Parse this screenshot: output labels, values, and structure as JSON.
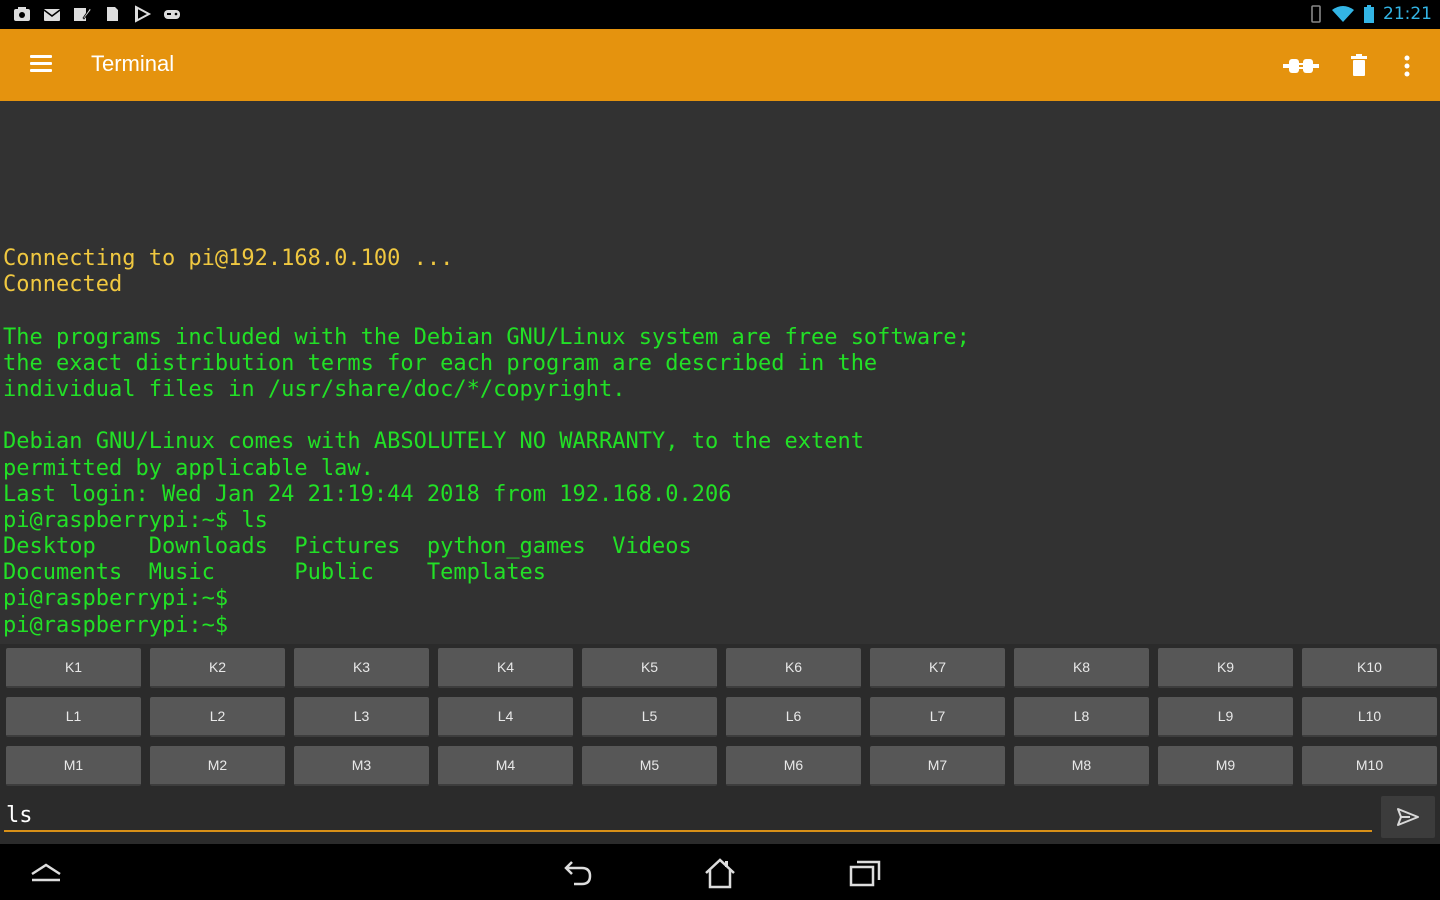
{
  "status_bar": {
    "left_icons": [
      "notification-icon",
      "mail-icon",
      "edit-icon",
      "document-icon",
      "play-store-icon",
      "gamepad-icon"
    ],
    "time": "21:21",
    "right_icons": [
      "vibrate-icon",
      "wifi-icon",
      "battery-icon"
    ]
  },
  "toolbar": {
    "title": "Terminal",
    "actions": [
      "connect-icon",
      "delete-icon",
      "overflow-menu-icon"
    ]
  },
  "terminal": {
    "lines": [
      {
        "text": "Connecting to pi@192.168.0.100 ...",
        "color": "yellow"
      },
      {
        "text": "Connected",
        "color": "yellow"
      },
      {
        "text": "",
        "color": "green"
      },
      {
        "text": "The programs included with the Debian GNU/Linux system are free software;",
        "color": "green"
      },
      {
        "text": "the exact distribution terms for each program are described in the",
        "color": "green"
      },
      {
        "text": "individual files in /usr/share/doc/*/copyright.",
        "color": "green"
      },
      {
        "text": "",
        "color": "green"
      },
      {
        "text": "Debian GNU/Linux comes with ABSOLUTELY NO WARRANTY, to the extent",
        "color": "green"
      },
      {
        "text": "permitted by applicable law.",
        "color": "green"
      },
      {
        "text": "Last login: Wed Jan 24 21:19:44 2018 from 192.168.0.206",
        "color": "green"
      },
      {
        "text": "pi@raspberrypi:~$ ls",
        "color": "green"
      },
      {
        "text": "Desktop    Downloads  Pictures  python_games  Videos",
        "color": "green"
      },
      {
        "text": "Documents  Music      Public    Templates",
        "color": "green"
      },
      {
        "text": "pi@raspberrypi:~$",
        "color": "green"
      },
      {
        "text": "pi@raspberrypi:~$",
        "color": "green"
      }
    ]
  },
  "keys": {
    "row_k": [
      "K1",
      "K2",
      "K3",
      "K4",
      "K5",
      "K6",
      "K7",
      "K8",
      "K9",
      "K10"
    ],
    "row_l": [
      "L1",
      "L2",
      "L3",
      "L4",
      "L5",
      "L6",
      "L7",
      "L8",
      "L9",
      "L10"
    ],
    "row_m": [
      "M1",
      "M2",
      "M3",
      "M4",
      "M5",
      "M6",
      "M7",
      "M8",
      "M9",
      "M10"
    ]
  },
  "input": {
    "value": "ls",
    "send_icon": "send-icon"
  },
  "nav_bar": {
    "buttons": [
      "keyboard-toggle-icon",
      "back-icon",
      "home-icon",
      "recent-apps-icon"
    ]
  },
  "colors": {
    "toolbar_bg": "#e5930e",
    "terminal_bg": "#323232",
    "text_yellow": "#f0c840",
    "text_green": "#22e026",
    "key_bg": "#575757",
    "input_underline": "#d89018"
  }
}
